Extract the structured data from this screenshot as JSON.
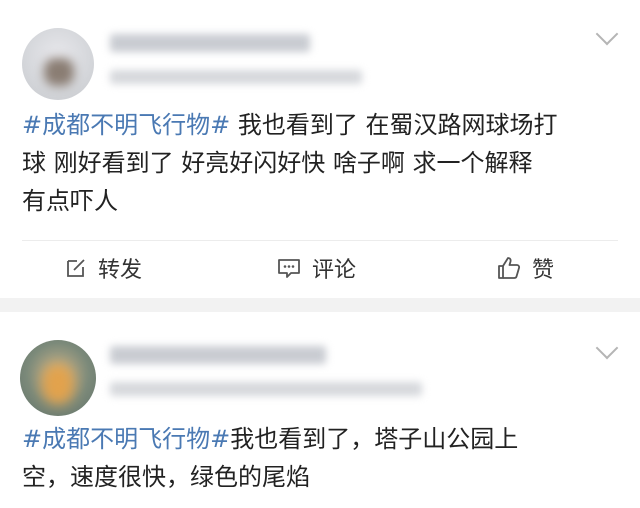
{
  "posts": [
    {
      "hashtag": "#成都不明飞行物#",
      "lines": [
        " 我也看到了 在蜀汉路网球场打",
        "球 刚好看到了 好亮好闪好快 啥子啊 求一个解释",
        "有点吓人"
      ],
      "actions": {
        "forward_label": "转发",
        "comment_label": "评论",
        "like_label": "赞"
      }
    },
    {
      "hashtag": "#成都不明飞行物#",
      "lines": [
        "我也看到了，塔子山公园上",
        "空，速度很快，绿色的尾焰"
      ]
    }
  ],
  "icons": {
    "more": "chevron-down-icon",
    "forward": "share-edit-icon",
    "comment": "comment-bubble-icon",
    "like": "thumbs-up-icon"
  },
  "colors": {
    "hashtag": "#4a79b3",
    "text": "#222222",
    "background": "#f2f2f2"
  }
}
